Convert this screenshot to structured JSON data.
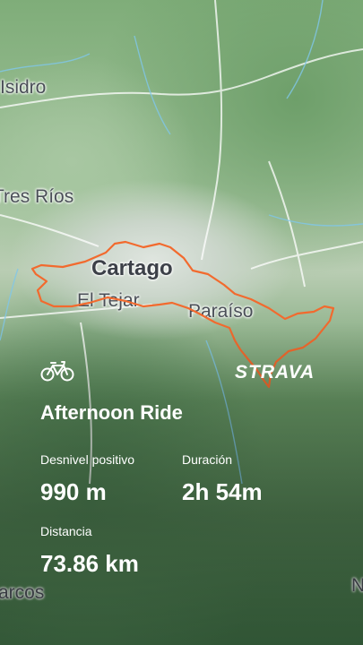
{
  "map": {
    "place_labels": {
      "isidro": "Isidro",
      "tres_rios": "Tres Ríos",
      "cartago": "Cartago",
      "el_tejar": "El Tejar",
      "paraiso": "Paraíso",
      "arcos": "arcos",
      "corner_n": "N"
    },
    "route_color": "#f26a2e"
  },
  "brand": {
    "name": "STRAVA",
    "activity_icon": "bicycle-icon"
  },
  "activity": {
    "title": "Afternoon Ride",
    "elevation_label": "Desnivel positivo",
    "elevation_value": "990 m",
    "duration_label": "Duración",
    "duration_value": "2h 54m",
    "distance_label": "Distancia",
    "distance_value": "73.86 km"
  }
}
